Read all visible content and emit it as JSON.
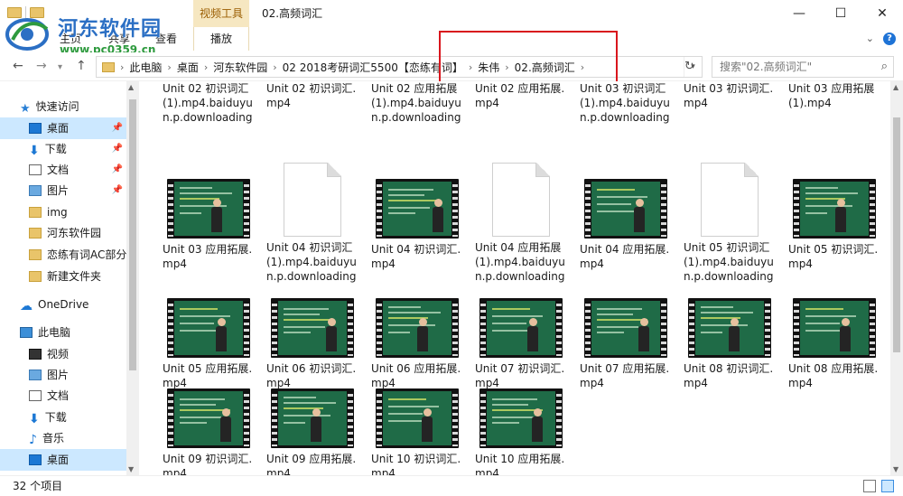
{
  "window": {
    "title": "02.高频词汇",
    "context_tab": "视频工具",
    "controls": {
      "minimize": "—",
      "maximize": "☐",
      "close": "✕"
    }
  },
  "ribbon": {
    "tabs": [
      "主页",
      "共享",
      "查看"
    ],
    "manage": "播放",
    "collapse": "⌄",
    "help": "?"
  },
  "watermark": {
    "name": "河东软件园",
    "url": "www.pc0359.cn"
  },
  "address": {
    "crumbs": [
      "此电脑",
      "桌面",
      "河东软件园",
      "02 2018考研词汇5500【恋练有词】",
      "朱伟",
      "02.高频词汇"
    ],
    "search_placeholder": "搜索\"02.高频词汇\""
  },
  "sidebar": {
    "quick_access": "快速访问",
    "quick_items": [
      {
        "label": "桌面",
        "pinned": true
      },
      {
        "label": "下载",
        "pinned": true
      },
      {
        "label": "文档",
        "pinned": true
      },
      {
        "label": "图片",
        "pinned": true
      },
      {
        "label": "img",
        "pinned": false
      },
      {
        "label": "河东软件园",
        "pinned": false
      },
      {
        "label": "恋练有词AC部分",
        "pinned": false
      },
      {
        "label": "新建文件夹",
        "pinned": false
      }
    ],
    "onedrive": "OneDrive",
    "this_pc": "此电脑",
    "pc_items": [
      "视频",
      "图片",
      "文档",
      "下载",
      "音乐",
      "桌面"
    ]
  },
  "files": [
    {
      "name": "Unit 02 初识词汇(1).mp4.baiduyun.p.downloading",
      "kind": "none"
    },
    {
      "name": "Unit 02 初识词汇.mp4",
      "kind": "none"
    },
    {
      "name": "Unit 02 应用拓展(1).mp4.baiduyun.p.downloading",
      "kind": "none"
    },
    {
      "name": "Unit 02 应用拓展.mp4",
      "kind": "none"
    },
    {
      "name": "Unit 03 初识词汇(1).mp4.baiduyun.p.downloading",
      "kind": "none"
    },
    {
      "name": "Unit 03 初识词汇.mp4",
      "kind": "none"
    },
    {
      "name": "Unit 03 应用拓展(1).mp4",
      "kind": "none"
    },
    {
      "name": "Unit 03 应用拓展.mp4",
      "kind": "video"
    },
    {
      "name": "Unit 04 初识词汇(1).mp4.baiduyun.p.downloading",
      "kind": "doc"
    },
    {
      "name": "Unit 04 初识词汇.mp4",
      "kind": "video"
    },
    {
      "name": "Unit 04 应用拓展(1).mp4.baiduyun.p.downloading",
      "kind": "doc"
    },
    {
      "name": "Unit 04 应用拓展.mp4",
      "kind": "video"
    },
    {
      "name": "Unit 05 初识词汇(1).mp4.baiduyun.p.downloading",
      "kind": "doc"
    },
    {
      "name": "Unit 05 初识词汇.mp4",
      "kind": "video"
    },
    {
      "name": "Unit 05 应用拓展.mp4",
      "kind": "video"
    },
    {
      "name": "Unit 06 初识词汇.mp4",
      "kind": "video"
    },
    {
      "name": "Unit 06 应用拓展.mp4",
      "kind": "video"
    },
    {
      "name": "Unit 07 初识词汇.mp4",
      "kind": "video"
    },
    {
      "name": "Unit 07 应用拓展.mp4",
      "kind": "video"
    },
    {
      "name": "Unit 08 初识词汇.mp4",
      "kind": "video"
    },
    {
      "name": "Unit 08 应用拓展.mp4",
      "kind": "video"
    },
    {
      "name": "Unit 09 初识词汇.mp4",
      "kind": "video"
    },
    {
      "name": "Unit 09 应用拓展.mp4",
      "kind": "video"
    },
    {
      "name": "Unit 10 初识词汇.mp4",
      "kind": "video"
    },
    {
      "name": "Unit 10 应用拓展.mp4",
      "kind": "video"
    }
  ],
  "status": {
    "count": "32 个项目"
  },
  "colors": {
    "accent": "#1c78d4",
    "selection": "#cce8ff",
    "highlight_box": "#d9161d",
    "board": "#1f6b47"
  }
}
